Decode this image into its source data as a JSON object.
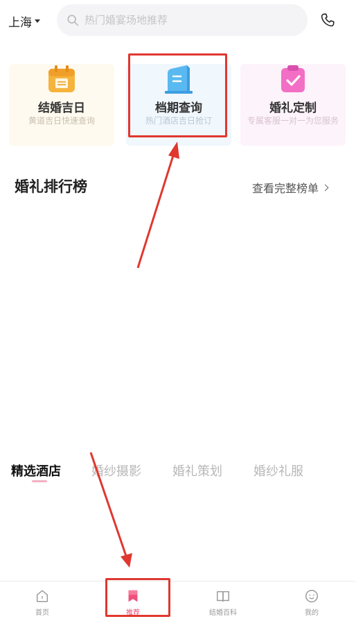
{
  "header": {
    "city": "上海",
    "search_placeholder": "热门婚宴场地推荐"
  },
  "cards": [
    {
      "title": "结婚吉日",
      "subtitle": "黄道吉日快速查询"
    },
    {
      "title": "档期查询",
      "subtitle": "热门酒店吉日抢订"
    },
    {
      "title": "婚礼定制",
      "subtitle": "专属客服一对一为您服务"
    }
  ],
  "ranking": {
    "title": "婚礼排行榜",
    "more": "查看完整榜单"
  },
  "tabs": [
    "精选酒店",
    "婚纱摄影",
    "婚礼策划",
    "婚纱礼服"
  ],
  "active_tab": "精选酒店",
  "bottom_nav": [
    {
      "label": "首页",
      "icon": "home-icon"
    },
    {
      "label": "推荐",
      "icon": "bookmark-icon"
    },
    {
      "label": "结婚百科",
      "icon": "book-icon"
    },
    {
      "label": "我的",
      "icon": "profile-icon"
    }
  ],
  "active_nav": "推荐",
  "colors": {
    "accent": "#f0507a",
    "annotation": "#e0372f",
    "search_bg": "#f4f4f6"
  }
}
